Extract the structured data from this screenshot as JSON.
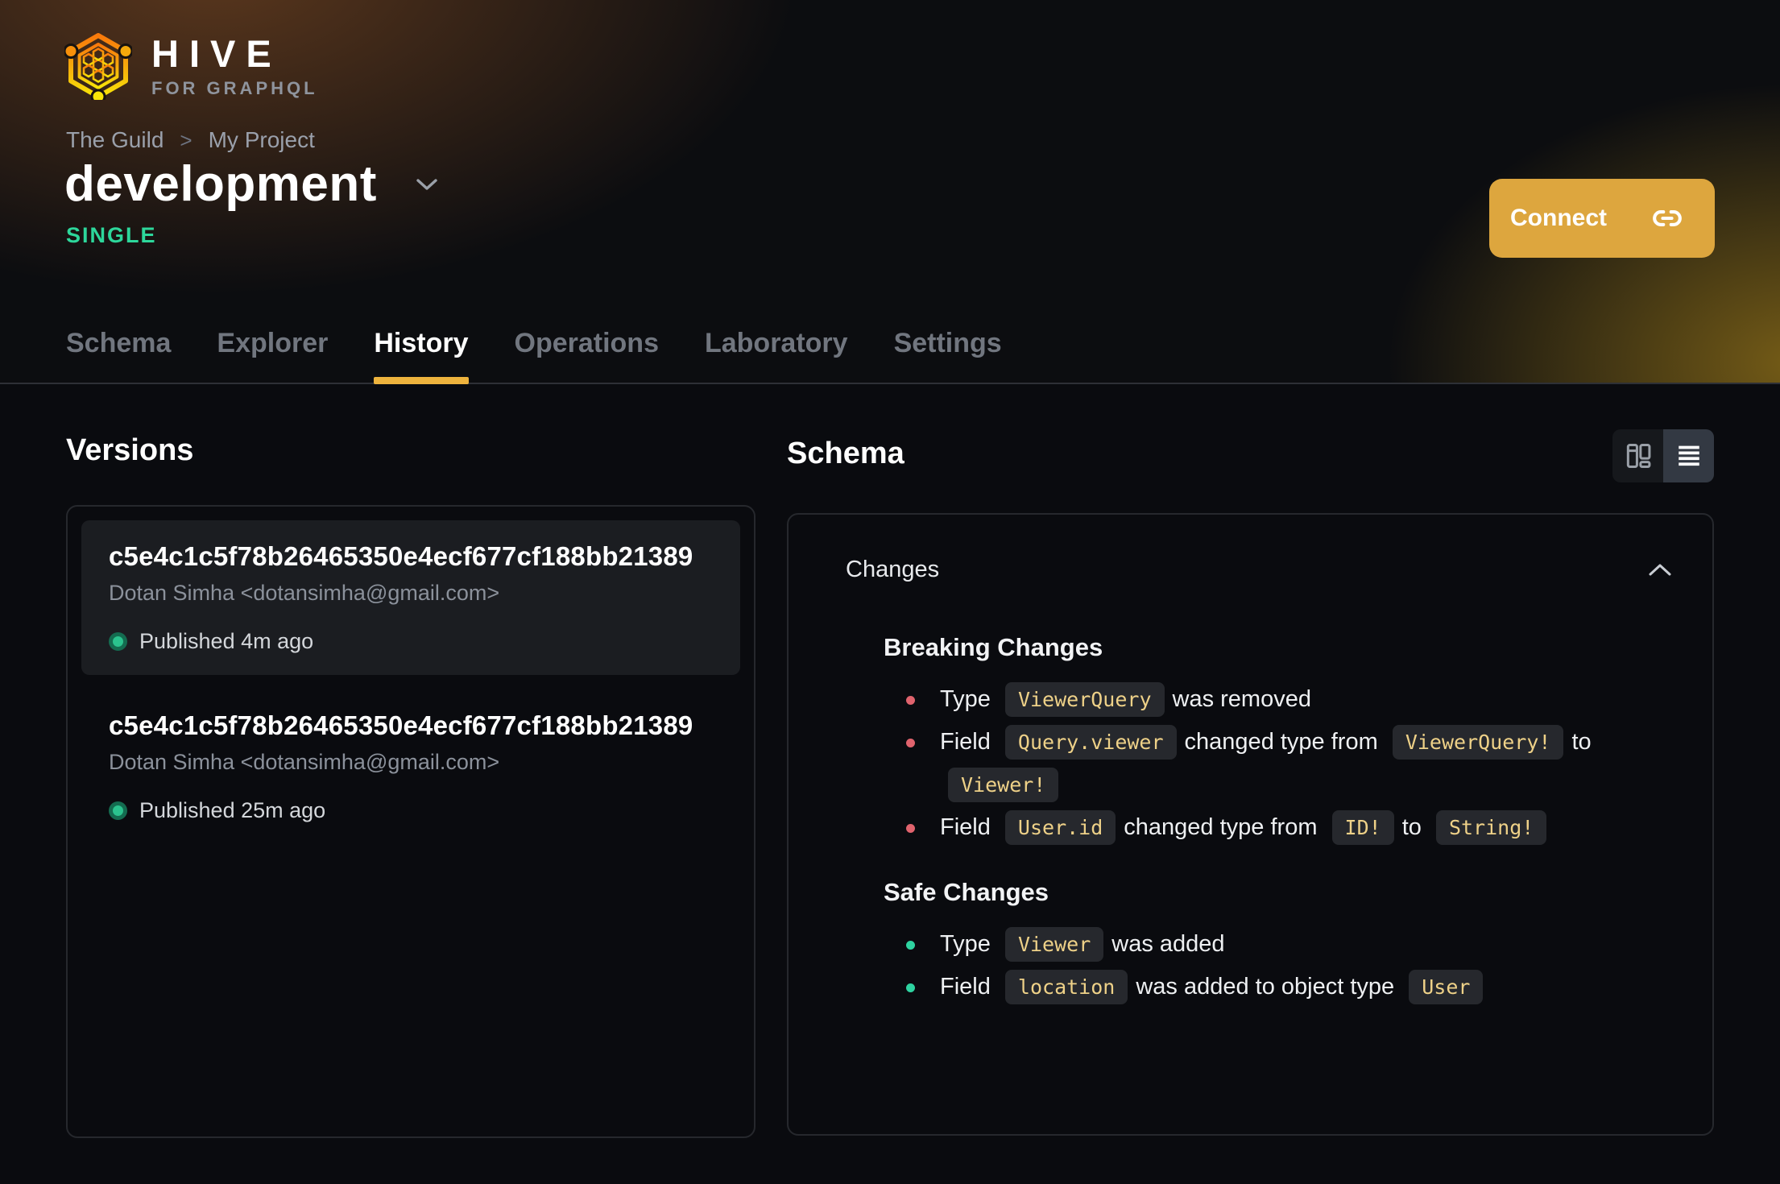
{
  "brand": {
    "name": "HIVE",
    "tagline": "FOR GRAPHQL"
  },
  "breadcrumb": {
    "items": [
      "The Guild",
      "My Project"
    ],
    "separator": ">"
  },
  "project": {
    "name": "development",
    "badge": "SINGLE"
  },
  "actions": {
    "connect_label": "Connect"
  },
  "tabs": [
    {
      "label": "Schema",
      "active": false
    },
    {
      "label": "Explorer",
      "active": false
    },
    {
      "label": "History",
      "active": true
    },
    {
      "label": "Operations",
      "active": false
    },
    {
      "label": "Laboratory",
      "active": false
    },
    {
      "label": "Settings",
      "active": false
    }
  ],
  "versions": {
    "title": "Versions",
    "items": [
      {
        "hash": "c5e4c1c5f78b26465350e4ecf677cf188bb21389",
        "author": "Dotan Simha <dotansimha@gmail.com>",
        "status": "Published 4m ago",
        "selected": true
      },
      {
        "hash": "c5e4c1c5f78b26465350e4ecf677cf188bb21389",
        "author": "Dotan Simha <dotansimha@gmail.com>",
        "status": "Published 25m ago",
        "selected": false
      }
    ]
  },
  "schema_panel": {
    "title": "Schema",
    "changes_label": "Changes",
    "view_toggle": [
      {
        "name": "columns-view",
        "active": false
      },
      {
        "name": "list-view",
        "active": true
      }
    ],
    "sections": [
      {
        "title": "Breaking Changes",
        "kind": "breaking",
        "items": [
          [
            {
              "t": "text",
              "v": "Type"
            },
            {
              "t": "code",
              "v": "ViewerQuery"
            },
            {
              "t": "text",
              "v": "was removed"
            }
          ],
          [
            {
              "t": "text",
              "v": "Field"
            },
            {
              "t": "code",
              "v": "Query.viewer"
            },
            {
              "t": "text",
              "v": "changed type from"
            },
            {
              "t": "code",
              "v": "ViewerQuery!"
            },
            {
              "t": "text",
              "v": "to"
            },
            {
              "t": "code",
              "v": "Viewer!"
            }
          ],
          [
            {
              "t": "text",
              "v": "Field"
            },
            {
              "t": "code",
              "v": "User.id"
            },
            {
              "t": "text",
              "v": "changed type from"
            },
            {
              "t": "code",
              "v": "ID!"
            },
            {
              "t": "text",
              "v": "to"
            },
            {
              "t": "code",
              "v": "String!"
            }
          ]
        ]
      },
      {
        "title": "Safe Changes",
        "kind": "safe",
        "items": [
          [
            {
              "t": "text",
              "v": "Type"
            },
            {
              "t": "code",
              "v": "Viewer"
            },
            {
              "t": "text",
              "v": "was added"
            }
          ],
          [
            {
              "t": "text",
              "v": "Field"
            },
            {
              "t": "code",
              "v": "location"
            },
            {
              "t": "text",
              "v": "was added to object type"
            },
            {
              "t": "code",
              "v": "User"
            }
          ]
        ]
      }
    ]
  },
  "colors": {
    "accent_amber": "#dda63e",
    "tab_underline": "#eeb33d",
    "badge_green": "#2dd79b",
    "published_dot": "#2bc38e",
    "breaking_bullet": "#e0636d",
    "safe_bullet": "#2ed3a0",
    "code_text": "#eed188",
    "code_bg": "#26282d",
    "card_bg": "#1b1d21",
    "panel_border": "#26282d"
  }
}
